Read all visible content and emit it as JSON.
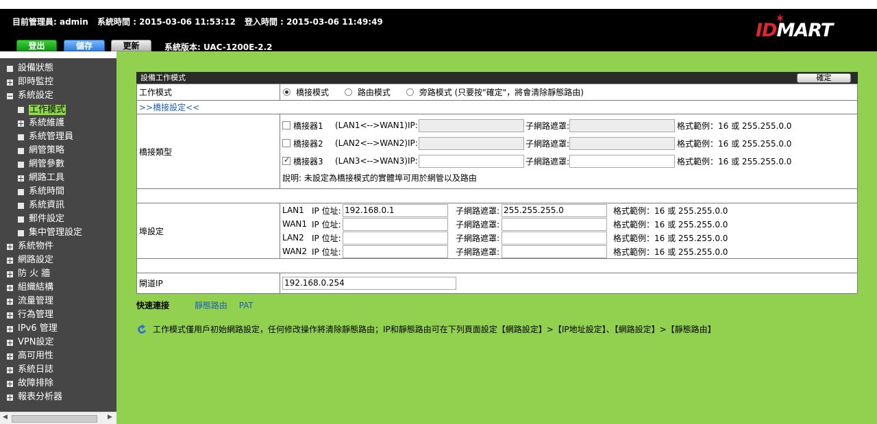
{
  "header": {
    "admin": "目前管理員: admin",
    "system_time": "系統時間 : 2015-03-06 11:53:12",
    "login_time": "登入時間 : 2015-03-06 11:49:49",
    "logout_label": "登出",
    "save_label": "儲存",
    "refresh_label": "更新",
    "version": "系統版本: UAC-1200E-2.2",
    "logo_id": "ID",
    "logo_mart": "MART"
  },
  "sidebar": {
    "items": [
      {
        "label": "設備狀態",
        "icon": "square"
      },
      {
        "label": "即時監控",
        "icon": "plus"
      },
      {
        "label": "系統設定",
        "icon": "minus"
      },
      {
        "label": "工作模式",
        "icon": "square",
        "active": true
      },
      {
        "label": "系統維護",
        "icon": "plus"
      },
      {
        "label": "系統管理員",
        "icon": "square"
      },
      {
        "label": "網管策略",
        "icon": "square"
      },
      {
        "label": "網管參數",
        "icon": "square"
      },
      {
        "label": "網路工具",
        "icon": "plus"
      },
      {
        "label": "系統時間",
        "icon": "square"
      },
      {
        "label": "系統資訊",
        "icon": "square"
      },
      {
        "label": "郵件設定",
        "icon": "square"
      },
      {
        "label": "集中管理設定",
        "icon": "square"
      },
      {
        "label": "系統物件",
        "icon": "plus"
      },
      {
        "label": "網路設定",
        "icon": "plus"
      },
      {
        "label": "防 火 牆",
        "icon": "plus"
      },
      {
        "label": "組織結構",
        "icon": "plus"
      },
      {
        "label": "流量管理",
        "icon": "plus"
      },
      {
        "label": "行為管理",
        "icon": "plus"
      },
      {
        "label": "IPv6 管理",
        "icon": "plus"
      },
      {
        "label": "VPN設定",
        "icon": "plus"
      },
      {
        "label": "高可用性",
        "icon": "plus"
      },
      {
        "label": "系統日誌",
        "icon": "plus"
      },
      {
        "label": "故障排除",
        "icon": "plus"
      },
      {
        "label": "報表分析器",
        "icon": "plus"
      }
    ]
  },
  "panel": {
    "title": "設備工作模式",
    "confirm_label": "確定",
    "mode_label": "工作模式",
    "mode_options": [
      "橋接模式",
      "路由模式",
      "旁路模式 (只要按\"確定\"，將會清除靜態路由)"
    ],
    "bridge_link": ">>橋接設定<<",
    "bridge_type_label": "橋接類型",
    "bridges": [
      {
        "name": "橋接器1",
        "ports": "(LAN1<-->WAN1)",
        "ip_label": "IP:",
        "ip": "",
        "mask_label": "子網路遮罩:",
        "mask": "",
        "checked": false,
        "disabled": true
      },
      {
        "name": "橋接器2",
        "ports": "(LAN2<-->WAN2)",
        "ip_label": "IP:",
        "ip": "",
        "mask_label": "子網路遮罩:",
        "mask": "",
        "checked": false,
        "disabled": true
      },
      {
        "name": "橋接器3",
        "ports": "(LAN3<-->WAN3)",
        "ip_label": "IP:",
        "ip": "",
        "mask_label": "子網路遮罩:",
        "mask": "",
        "checked": true,
        "disabled": false
      }
    ],
    "format_hint": "格式範例：16 或 255.255.0.0",
    "bridge_note": "說明: 未設定為橋接模式的實體埠可用於網管以及路由",
    "port_label": "埠設定",
    "ports": [
      {
        "name": "LAN1",
        "ip_label": "IP 位址:",
        "ip": "192.168.0.1",
        "mask_label": "子網路遮罩:",
        "mask": "255.255.255.0"
      },
      {
        "name": "WAN1",
        "ip_label": "IP 位址:",
        "ip": "",
        "mask_label": "子網路遮罩:",
        "mask": ""
      },
      {
        "name": "LAN2",
        "ip_label": "IP 位址:",
        "ip": "",
        "mask_label": "子網路遮罩:",
        "mask": ""
      },
      {
        "name": "WAN2",
        "ip_label": "IP 位址:",
        "ip": "",
        "mask_label": "子網路遮罩:",
        "mask": ""
      }
    ],
    "gateway_label": "閘道IP",
    "gateway_value": "192.168.0.254"
  },
  "quick": {
    "label": "快速連接",
    "links": [
      "靜態路由",
      "PAT"
    ]
  },
  "note": {
    "text": "工作模式僅用戶初始網路設定，任何修改操作將清除靜態路由；IP和靜態路由可在下列頁面設定【網路設定】>【IP地址設定】、【網路設定】>【靜態路由】"
  },
  "colors": {
    "main_bg": "#92d050",
    "sidebar_bg": "#464646",
    "header_bg": "#000000",
    "active_item": "#90d74a",
    "logo_red": "#e3252e"
  }
}
